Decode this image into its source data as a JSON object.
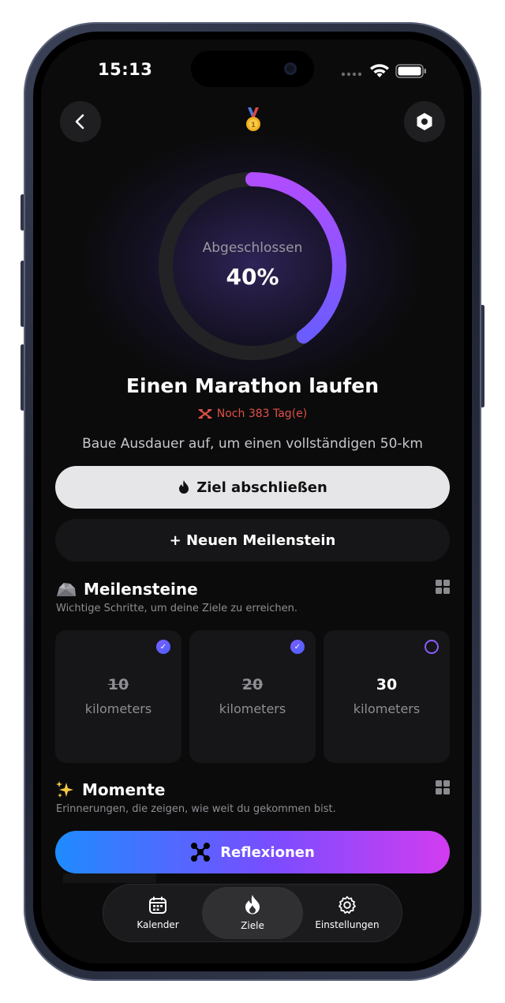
{
  "status_bar": {
    "time": "15:13"
  },
  "header": {
    "back_icon": "chevron-left-icon",
    "medal_icon": "medal-icon",
    "settings_icon": "hexagon-icon"
  },
  "progress": {
    "label": "Abgeschlossen",
    "value_text": "40%",
    "fraction": 0.4,
    "gradient": [
      "#b04dff",
      "#6a5cff"
    ]
  },
  "goal": {
    "title": "Einen Marathon laufen",
    "days_left": "Noch 383 Tag(e)",
    "days_color": "#e05045",
    "description": "Baue Ausdauer auf, um einen vollständigen 50-km"
  },
  "actions": {
    "complete_label": "Ziel abschließen",
    "add_milestone_label": "+ Neuen Meilenstein"
  },
  "milestones": {
    "title": "Meilensteine",
    "subtitle": "Wichtige Schritte, um deine Ziele zu erreichen.",
    "items": [
      {
        "value": "10",
        "unit": "kilometers",
        "done": true
      },
      {
        "value": "20",
        "unit": "kilometers",
        "done": true
      },
      {
        "value": "30",
        "unit": "kilometers",
        "done": false
      }
    ]
  },
  "moments": {
    "title": "Momente",
    "subtitle": "Erinnerungen, die zeigen, wie weit du gekommen bist.",
    "reflect_label": "Reflexionen"
  },
  "tabbar": {
    "items": [
      {
        "label": "Kalender",
        "icon": "calendar-icon"
      },
      {
        "label": "Ziele",
        "icon": "flame-icon",
        "active": true
      },
      {
        "label": "Einstellungen",
        "icon": "gear-icon"
      }
    ]
  }
}
